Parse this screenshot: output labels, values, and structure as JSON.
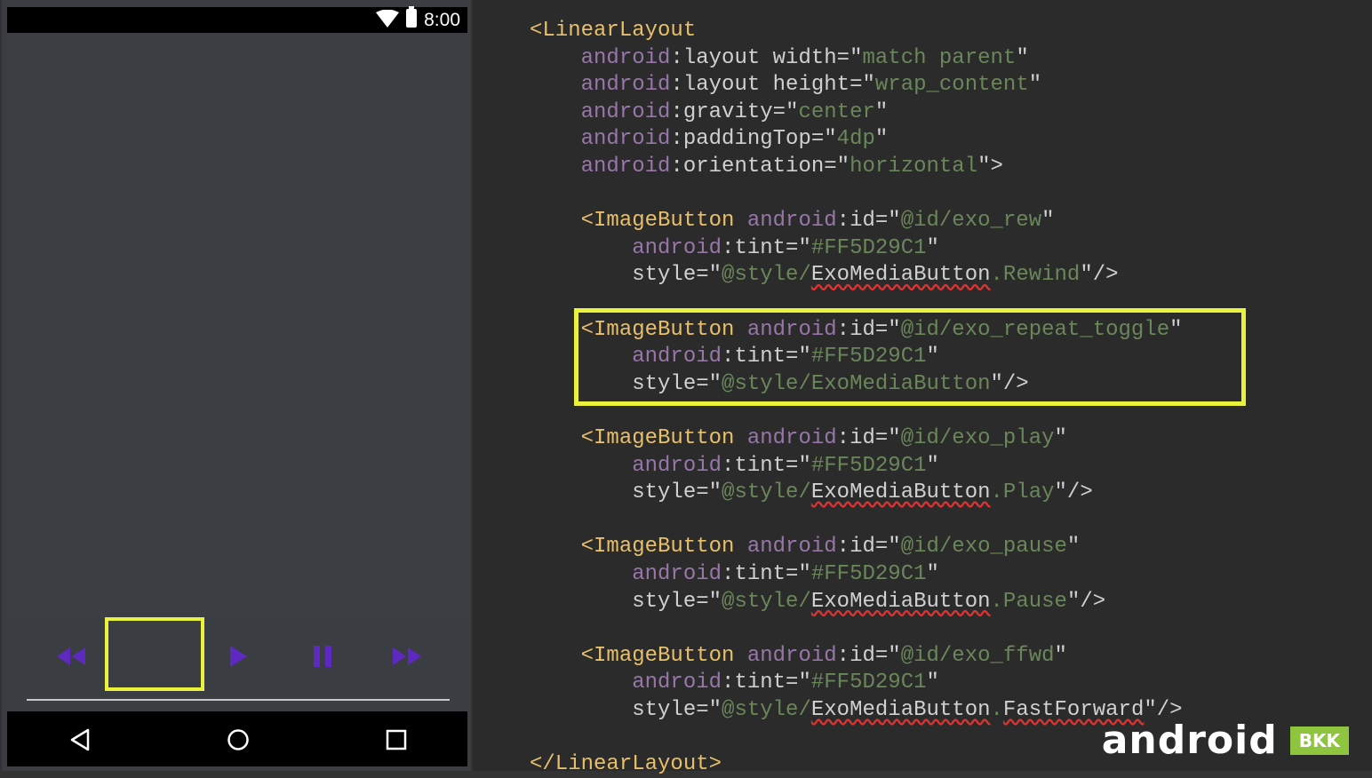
{
  "status_bar": {
    "time": "8:00"
  },
  "player": {
    "icons": [
      "rewind-icon",
      "repeat-toggle-empty",
      "play-icon",
      "pause-icon",
      "fast-forward-icon"
    ],
    "accent_color": "#5D29C1",
    "highlight_color": "#EAF23D"
  },
  "nav_bar": {
    "icons": [
      "back-icon",
      "home-icon",
      "recents-icon"
    ]
  },
  "code": {
    "lines": [
      [
        [
          "tag",
          "<LinearLayout"
        ]
      ],
      [
        [
          "ns",
          "    android"
        ],
        [
          "attr",
          ":layout width="
        ],
        [
          "q",
          "\""
        ],
        [
          "val",
          "match parent"
        ],
        [
          "q",
          "\""
        ]
      ],
      [
        [
          "ns",
          "    android"
        ],
        [
          "attr",
          ":layout height="
        ],
        [
          "q",
          "\""
        ],
        [
          "val",
          "wrap_content"
        ],
        [
          "q",
          "\""
        ]
      ],
      [
        [
          "ns",
          "    android"
        ],
        [
          "attr",
          ":gravity="
        ],
        [
          "q",
          "\""
        ],
        [
          "val",
          "center"
        ],
        [
          "q",
          "\""
        ]
      ],
      [
        [
          "ns",
          "    android"
        ],
        [
          "attr",
          ":paddingTop="
        ],
        [
          "q",
          "\""
        ],
        [
          "val",
          "4dp"
        ],
        [
          "q",
          "\""
        ]
      ],
      [
        [
          "ns",
          "    android"
        ],
        [
          "attr",
          ":orientation="
        ],
        [
          "q",
          "\""
        ],
        [
          "val",
          "horizontal"
        ],
        [
          "q",
          "\">"
        ]
      ],
      [],
      [
        [
          "tag",
          "    <ImageButton "
        ],
        [
          "ns",
          "android"
        ],
        [
          "attr",
          ":id="
        ],
        [
          "q",
          "\""
        ],
        [
          "val",
          "@id/exo_rew"
        ],
        [
          "q",
          "\""
        ]
      ],
      [
        [
          "ns",
          "        android"
        ],
        [
          "attr",
          ":tint="
        ],
        [
          "q",
          "\""
        ],
        [
          "val",
          "#FF5D29C1"
        ],
        [
          "q",
          "\""
        ]
      ],
      [
        [
          "attr",
          "        style="
        ],
        [
          "q",
          "\""
        ],
        [
          "val",
          "@style/"
        ],
        [
          "squig",
          "ExoMediaButton"
        ],
        [
          "val",
          ".Rewind"
        ],
        [
          "q",
          "\"/>"
        ]
      ],
      [],
      [
        [
          "tag",
          "    <ImageButton "
        ],
        [
          "ns",
          "android"
        ],
        [
          "attr",
          ":id="
        ],
        [
          "q",
          "\""
        ],
        [
          "val",
          "@id/exo_repeat_toggle"
        ],
        [
          "q",
          "\""
        ]
      ],
      [
        [
          "ns",
          "        android"
        ],
        [
          "attr",
          ":tint="
        ],
        [
          "q",
          "\""
        ],
        [
          "val",
          "#FF5D29C1"
        ],
        [
          "q",
          "\""
        ]
      ],
      [
        [
          "attr",
          "        style="
        ],
        [
          "q",
          "\""
        ],
        [
          "val",
          "@style/ExoMediaButton"
        ],
        [
          "q",
          "\"/>"
        ]
      ],
      [],
      [
        [
          "tag",
          "    <ImageButton "
        ],
        [
          "ns",
          "android"
        ],
        [
          "attr",
          ":id="
        ],
        [
          "q",
          "\""
        ],
        [
          "val",
          "@id/exo_play"
        ],
        [
          "q",
          "\""
        ]
      ],
      [
        [
          "ns",
          "        android"
        ],
        [
          "attr",
          ":tint="
        ],
        [
          "q",
          "\""
        ],
        [
          "val",
          "#FF5D29C1"
        ],
        [
          "q",
          "\""
        ]
      ],
      [
        [
          "attr",
          "        style="
        ],
        [
          "q",
          "\""
        ],
        [
          "val",
          "@style/"
        ],
        [
          "squig",
          "ExoMediaButton"
        ],
        [
          "val",
          ".Play"
        ],
        [
          "q",
          "\"/>"
        ]
      ],
      [],
      [
        [
          "tag",
          "    <ImageButton "
        ],
        [
          "ns",
          "android"
        ],
        [
          "attr",
          ":id="
        ],
        [
          "q",
          "\""
        ],
        [
          "val",
          "@id/exo_pause"
        ],
        [
          "q",
          "\""
        ]
      ],
      [
        [
          "ns",
          "        android"
        ],
        [
          "attr",
          ":tint="
        ],
        [
          "q",
          "\""
        ],
        [
          "val",
          "#FF5D29C1"
        ],
        [
          "q",
          "\""
        ]
      ],
      [
        [
          "attr",
          "        style="
        ],
        [
          "q",
          "\""
        ],
        [
          "val",
          "@style/"
        ],
        [
          "squig",
          "ExoMediaButton"
        ],
        [
          "val",
          ".Pause"
        ],
        [
          "q",
          "\"/>"
        ]
      ],
      [],
      [
        [
          "tag",
          "    <ImageButton "
        ],
        [
          "ns",
          "android"
        ],
        [
          "attr",
          ":id="
        ],
        [
          "q",
          "\""
        ],
        [
          "val",
          "@id/exo_ffwd"
        ],
        [
          "q",
          "\""
        ]
      ],
      [
        [
          "ns",
          "        android"
        ],
        [
          "attr",
          ":tint="
        ],
        [
          "q",
          "\""
        ],
        [
          "val",
          "#FF5D29C1"
        ],
        [
          "q",
          "\""
        ]
      ],
      [
        [
          "attr",
          "        style="
        ],
        [
          "q",
          "\""
        ],
        [
          "val",
          "@style/"
        ],
        [
          "squig",
          "ExoMediaButton"
        ],
        [
          "val",
          "."
        ],
        [
          "squig",
          "FastForward"
        ],
        [
          "q",
          "\"/>"
        ]
      ],
      [],
      [
        [
          "tag",
          "</LinearLayout>"
        ]
      ]
    ]
  },
  "logo": {
    "text": "android",
    "badge": "BKK"
  }
}
